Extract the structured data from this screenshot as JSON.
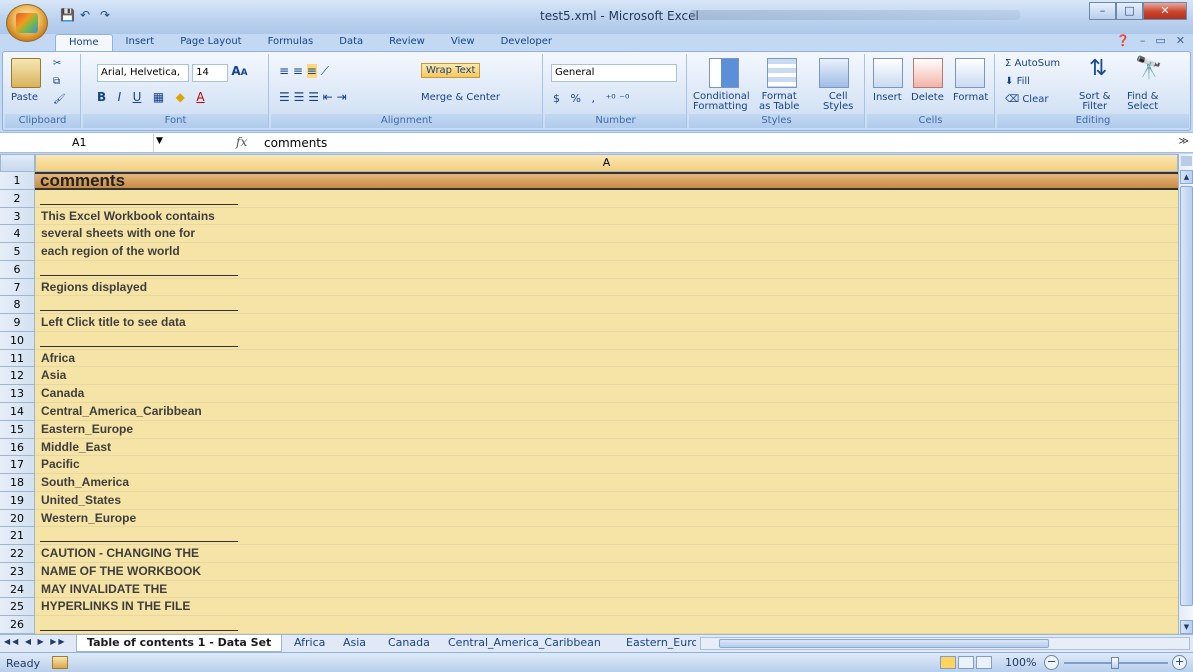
{
  "window": {
    "title": "test5.xml - Microsoft Excel"
  },
  "ribbon_tabs": [
    "Home",
    "Insert",
    "Page Layout",
    "Formulas",
    "Data",
    "Review",
    "View",
    "Developer"
  ],
  "ribbon": {
    "clipboard": {
      "paste": "Paste",
      "label": "Clipboard"
    },
    "font": {
      "name": "Arial, Helvetica,",
      "size": "14",
      "label": "Font"
    },
    "alignment": {
      "wrap_text": "Wrap Text",
      "merge_center": "Merge & Center",
      "label": "Alignment"
    },
    "number": {
      "format": "General",
      "currency": "$",
      "percent": "%",
      "comma": ",",
      "label": "Number"
    },
    "styles": {
      "conditional": "Conditional",
      "conditional2": "Formatting",
      "format_as": "Format",
      "format_as2": "as Table",
      "cell": "Cell",
      "cell2": "Styles",
      "label": "Styles"
    },
    "cells": {
      "insert": "Insert",
      "delete": "Delete",
      "format": "Format",
      "label": "Cells"
    },
    "editing": {
      "autosum": "AutoSum",
      "fill": "Fill",
      "clear": "Clear",
      "sort": "Sort &",
      "sort2": "Filter",
      "find": "Find &",
      "find2": "Select",
      "label": "Editing"
    }
  },
  "formula_bar": {
    "name_box": "A1",
    "fx": "fx",
    "formula": "comments"
  },
  "column_header": "A",
  "rows": [
    {
      "num": "1",
      "text": "comments",
      "type": "header"
    },
    {
      "num": "2",
      "text": "",
      "type": "sep"
    },
    {
      "num": "3",
      "text": "This Excel Workbook contains",
      "type": "text"
    },
    {
      "num": "4",
      "text": "several sheets with one for",
      "type": "text"
    },
    {
      "num": "5",
      "text": "each region of the world",
      "type": "text"
    },
    {
      "num": "6",
      "text": "",
      "type": "sep"
    },
    {
      "num": "7",
      "text": "Regions displayed",
      "type": "text"
    },
    {
      "num": "8",
      "text": "",
      "type": "sep"
    },
    {
      "num": "9",
      "text": "Left Click title to see data",
      "type": "text"
    },
    {
      "num": "10",
      "text": "",
      "type": "sep"
    },
    {
      "num": "11",
      "text": "Africa",
      "type": "text"
    },
    {
      "num": "12",
      "text": "Asia",
      "type": "text"
    },
    {
      "num": "13",
      "text": "Canada",
      "type": "text"
    },
    {
      "num": "14",
      "text": "Central_America_Caribbean",
      "type": "text"
    },
    {
      "num": "15",
      "text": "Eastern_Europe",
      "type": "text"
    },
    {
      "num": "16",
      "text": "Middle_East",
      "type": "text"
    },
    {
      "num": "17",
      "text": "Pacific",
      "type": "text"
    },
    {
      "num": "18",
      "text": "South_America",
      "type": "text"
    },
    {
      "num": "19",
      "text": "United_States",
      "type": "text"
    },
    {
      "num": "20",
      "text": "Western_Europe",
      "type": "text"
    },
    {
      "num": "21",
      "text": "",
      "type": "sep"
    },
    {
      "num": "22",
      "text": "CAUTION - CHANGING THE",
      "type": "text"
    },
    {
      "num": "23",
      "text": "NAME OF THE WORKBOOK",
      "type": "text"
    },
    {
      "num": "24",
      "text": "MAY INVALIDATE THE",
      "type": "text"
    },
    {
      "num": "25",
      "text": "HYPERLINKS IN THE FILE",
      "type": "text"
    },
    {
      "num": "26",
      "text": "",
      "type": "sep"
    }
  ],
  "sheet_tabs": [
    "Table of contents 1 - Data Set",
    "Africa",
    "Asia",
    "Canada",
    "Central_America_Caribbean",
    "Eastern_Europ"
  ],
  "status": {
    "ready": "Ready",
    "zoom": "100%"
  }
}
